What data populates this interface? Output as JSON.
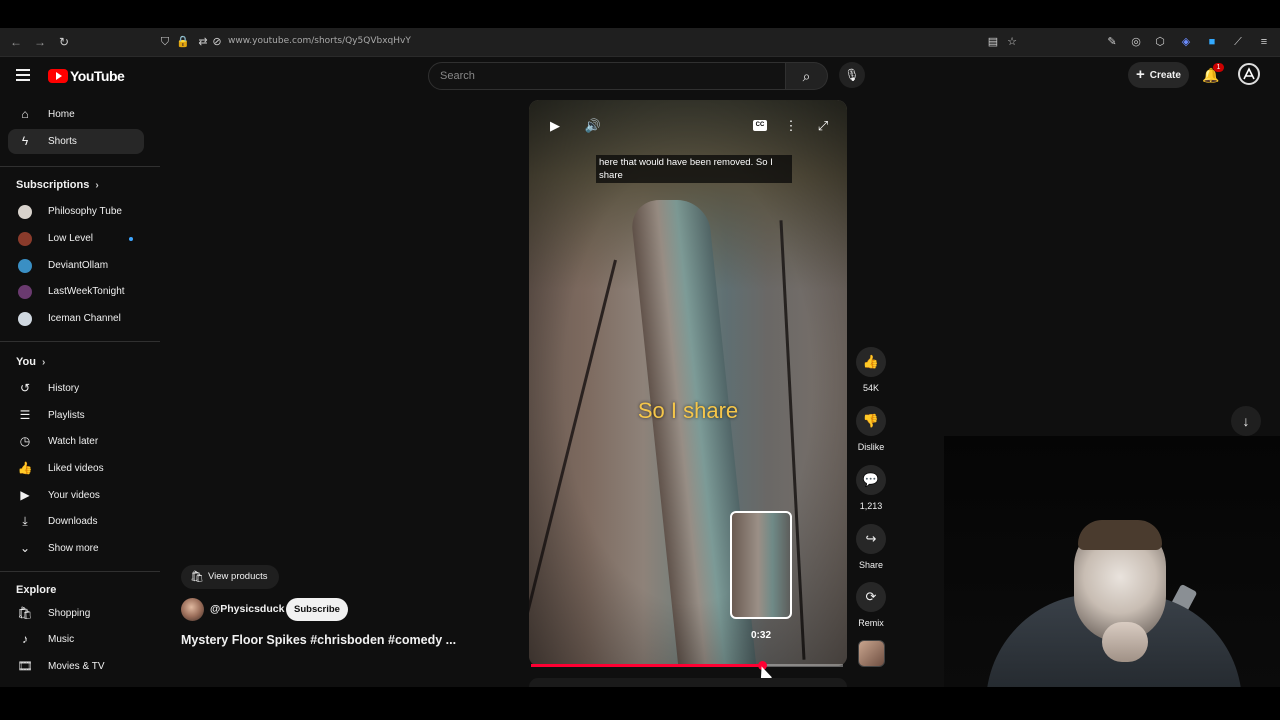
{
  "browser": {
    "url": "www.youtube.com/shorts/Qy5QVbxqHvY"
  },
  "header": {
    "logo_text": "YouTube",
    "search_placeholder": "Search",
    "create_label": "Create",
    "notification_count": "1"
  },
  "sidebar": {
    "main": [
      {
        "label": "Home",
        "icon": "home-icon"
      },
      {
        "label": "Shorts",
        "icon": "shorts-icon",
        "active": true
      }
    ],
    "subscriptions_title": "Subscriptions",
    "subscriptions": [
      {
        "label": "Philosophy Tube",
        "color": "#d8d2cc"
      },
      {
        "label": "Low Level",
        "color": "#8a3b2b",
        "new": true
      },
      {
        "label": "DeviantOllam",
        "color": "#3a8fc4"
      },
      {
        "label": "LastWeekTonight",
        "color": "#6a3a6f"
      },
      {
        "label": "Iceman Channel",
        "color": "#d0d8e0"
      }
    ],
    "you_title": "You",
    "you": [
      {
        "label": "History",
        "icon": "history-icon"
      },
      {
        "label": "Playlists",
        "icon": "playlists-icon"
      },
      {
        "label": "Watch later",
        "icon": "watch-later-icon"
      },
      {
        "label": "Liked videos",
        "icon": "liked-videos-icon"
      },
      {
        "label": "Your videos",
        "icon": "your-videos-icon"
      },
      {
        "label": "Downloads",
        "icon": "downloads-icon"
      },
      {
        "label": "Show more",
        "icon": "chevron-down-icon"
      }
    ],
    "explore_title": "Explore",
    "explore": [
      {
        "label": "Shopping",
        "icon": "shopping-icon"
      },
      {
        "label": "Music",
        "icon": "music-icon"
      },
      {
        "label": "Movies & TV",
        "icon": "movies-icon"
      }
    ]
  },
  "video": {
    "caption_small": "here that would have been removed. So I share",
    "caption_big": "So I share",
    "preview_time": "0:32",
    "progress_fraction": 0.74,
    "accent": "#ff0033"
  },
  "actions": {
    "likes": "54K",
    "dislike": "Dislike",
    "comments": "1,213",
    "share": "Share",
    "remix": "Remix"
  },
  "channel": {
    "view_products": "View products",
    "handle": "@Physicsduck",
    "subscribe_label": "Subscribe",
    "title": "Mystery Floor Spikes #chrisboden #comedy ..."
  }
}
